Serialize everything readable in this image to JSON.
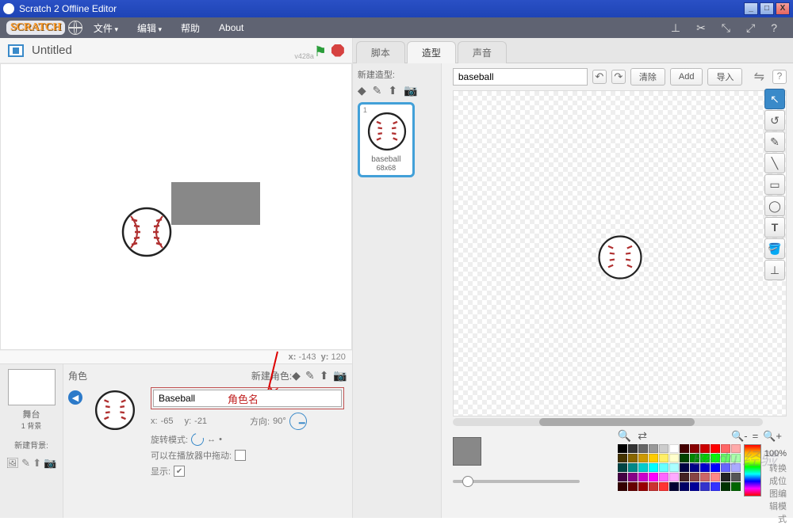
{
  "window": {
    "title": "Scratch 2 Offline Editor"
  },
  "menubar": {
    "logo": "SCRATCH",
    "items": [
      "文件",
      "编辑",
      "帮助",
      "About"
    ]
  },
  "stage": {
    "title": "Untitled",
    "version": "v428a",
    "coords_prefix_x": "x:",
    "coords_prefix_y": "y:",
    "mouse_x": "-143",
    "mouse_y": "120"
  },
  "spritesPanel": {
    "sprites_label": "角色",
    "new_sprite_label": "新建角色:",
    "stage_label": "舞台",
    "backdrop_count": "1 背景",
    "new_backdrop_label": "新建背景:"
  },
  "spriteInfo": {
    "name": "Baseball",
    "role_name_label": "角色名",
    "x_label": "x:",
    "x_val": "-65",
    "y_label": "y:",
    "y_val": "-21",
    "direction_label": "方向:",
    "direction_val": "90°",
    "rotation_label": "旋转模式:",
    "drag_label": "可以在播放器中拖动:",
    "show_label": "显示:"
  },
  "tabs": {
    "scripts": "脚本",
    "costumes": "造型",
    "sounds": "声音"
  },
  "costumePanel": {
    "new_costume_label": "新建造型:",
    "costume": {
      "index": "1",
      "name": "baseball",
      "size": "68x68"
    }
  },
  "paintEditor": {
    "costume_name": "baseball",
    "clear": "清除",
    "add": "Add",
    "import": "导入",
    "zoom": "100%",
    "mode_switch": "转换成位图编辑模式"
  }
}
